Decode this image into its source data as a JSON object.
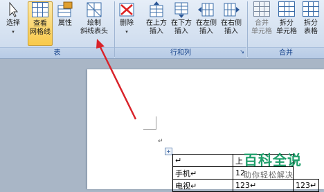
{
  "ribbon": {
    "groups": {
      "table": {
        "label": "表",
        "select": "选择",
        "view_gridlines_1": "查看",
        "view_gridlines_2": "网格线",
        "properties": "属性",
        "draw_diagonal_1": "绘制",
        "draw_diagonal_2": "斜线表头"
      },
      "rows_cols": {
        "label": "行和列",
        "delete": "删除",
        "insert_above_1": "在上方",
        "insert_above_2": "插入",
        "insert_below_1": "在下方",
        "insert_below_2": "插入",
        "insert_left_1": "在左侧",
        "insert_left_2": "插入",
        "insert_right_1": "在右侧",
        "insert_right_2": "插入"
      },
      "merge": {
        "label": "合并",
        "merge_cells_1": "合并",
        "merge_cells_2": "单元格",
        "split_cells_1": "拆分",
        "split_cells_2": "单元格",
        "split_table_1": "拆分",
        "split_table_2": "表格"
      }
    }
  },
  "document": {
    "table_move_handle": "+",
    "rows": [
      [
        "↵",
        "上"
      ],
      [
        "手机↵",
        "12"
      ],
      [
        "电视↵",
        "123↵",
        "123↵"
      ]
    ],
    "para_mark": "↵"
  },
  "watermark": {
    "title": "百科全说",
    "subtitle": "助你轻松解决"
  },
  "colors": {
    "arrow": "#d9232a",
    "active_button": "#f8c94a",
    "watermark": "#1e9e6a"
  }
}
